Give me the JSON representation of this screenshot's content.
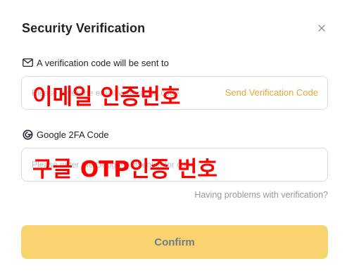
{
  "dialog": {
    "title": "Security Verification",
    "close_icon": "close-icon"
  },
  "email_field": {
    "label": "A verification code will be sent to",
    "icon": "envelope-icon",
    "placeholder": "Please enter the email verification code",
    "value": "",
    "send_code_label": "Send Verification Code",
    "overlay_annotation": "이메일 인증번호"
  },
  "twofa_field": {
    "label": "Google 2FA Code",
    "icon": "google-icon",
    "placeholder": "Please enter the Google Authenticator code",
    "value": "",
    "overlay_annotation": "구글 OTP인증 번호"
  },
  "help_link": "Having problems with verification?",
  "confirm_label": "Confirm",
  "colors": {
    "accent": "#e8a534",
    "confirm_bg": "#f8d36f",
    "annotation": "#ff0000",
    "text_primary": "#1e2329",
    "text_muted": "#929aa5"
  }
}
